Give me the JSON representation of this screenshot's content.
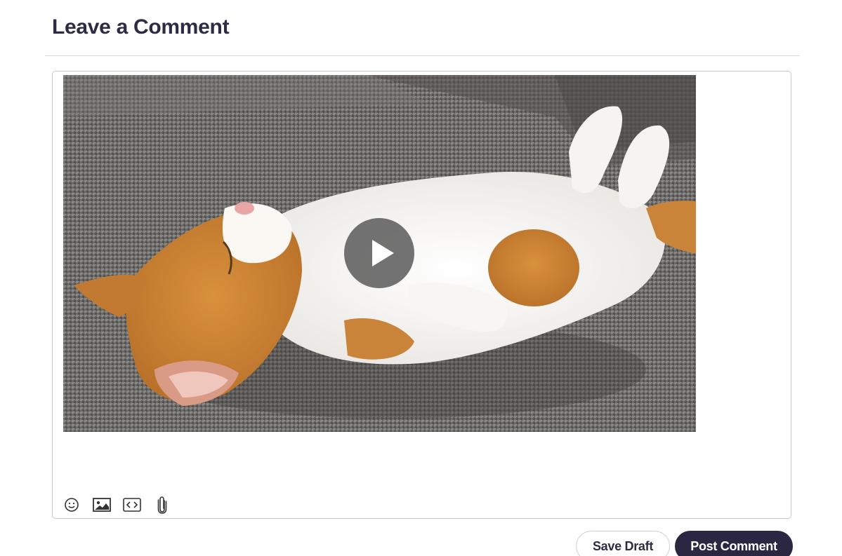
{
  "heading": "Leave a Comment",
  "editor": {
    "embed": {
      "type": "video",
      "thumbnail_subject": "orange and white kitten sleeping on its back on a grey sofa",
      "play_icon": "play-icon"
    },
    "toolbar": [
      {
        "name": "emoji",
        "icon": "smiley-icon"
      },
      {
        "name": "image",
        "icon": "image-icon"
      },
      {
        "name": "code",
        "icon": "code-icon"
      },
      {
        "name": "attachment",
        "icon": "paperclip-icon"
      }
    ]
  },
  "actions": {
    "save_draft": "Save Draft",
    "post_comment": "Post Comment"
  },
  "colors": {
    "heading": "#2e2c45",
    "primary_button": "#2b2742",
    "border": "#c9c9c9"
  }
}
